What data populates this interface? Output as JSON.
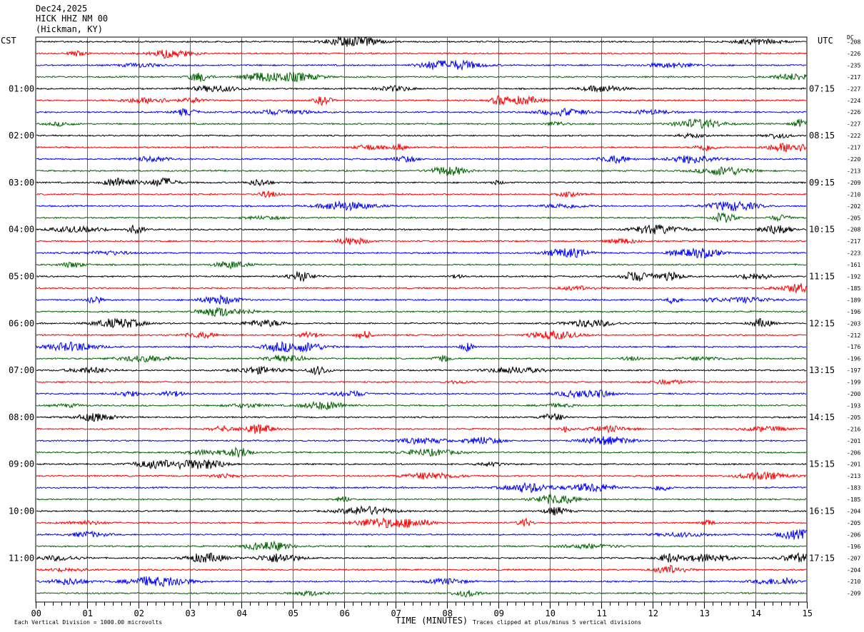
{
  "header": {
    "date": "Dec24,2025",
    "station": "HICK HHZ NM 00",
    "location": "(Hickman, KY)"
  },
  "axes": {
    "left_zone": "CST",
    "right_zone": "UTC",
    "dc_label": "DC",
    "xlabel": "TIME (MINUTES)",
    "footer_left": "Each Vertical Division = 1000.00 microvolts",
    "footer_right": "Traces clipped at plus/minus 5 vertical divisions"
  },
  "chart_data": {
    "type": "line",
    "title": "",
    "xlabel": "TIME (MINUTES)",
    "xlim": [
      0,
      15
    ],
    "x_ticks": [
      "00",
      "01",
      "02",
      "03",
      "04",
      "05",
      "06",
      "07",
      "08",
      "09",
      "10",
      "11",
      "12",
      "13",
      "14",
      "15"
    ],
    "trace_count": 48,
    "trace_colors": [
      "#000000",
      "#ff0000",
      "#0000ff",
      "#006400"
    ],
    "grid": true,
    "cst_hour_labels": [
      "01:00",
      "02:00",
      "03:00",
      "04:00",
      "05:00",
      "06:00",
      "07:00",
      "08:00",
      "09:00",
      "10:00",
      "11:00"
    ],
    "utc_labels": [
      "07:15",
      "08:15",
      "09:15",
      "10:15",
      "11:15",
      "12:15",
      "13:15",
      "14:15",
      "15:15",
      "16:15",
      "17:15"
    ],
    "dc_offsets": [
      "-208",
      "-226",
      "-235",
      "-217",
      "-227",
      "-224",
      "-226",
      "-227",
      "-222",
      "-217",
      "-220",
      "-213",
      "-209",
      "-210",
      "-202",
      "-205",
      "-208",
      "-217",
      "-223",
      "-161",
      "-192",
      "-185",
      "-189",
      "-196",
      "-203",
      "-212",
      "-176",
      "-196",
      "-197",
      "-199",
      "-200",
      "-193",
      "-205",
      "-216",
      "-201",
      "-206",
      "-201",
      "-213",
      "-183",
      "-185",
      "-204",
      "-205",
      "-206",
      "-196",
      "-207",
      "-204",
      "-210",
      "-209"
    ]
  }
}
